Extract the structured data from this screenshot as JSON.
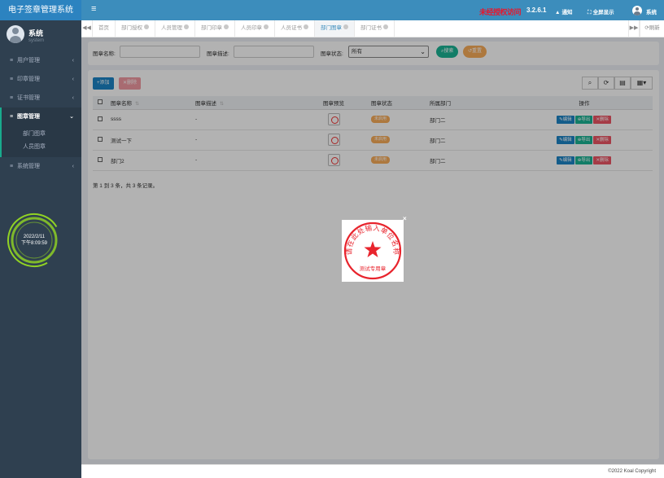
{
  "app": {
    "title": "电子签章管理系统"
  },
  "user": {
    "name": "系统",
    "role": "system"
  },
  "sidebar": {
    "items": [
      {
        "label": "用户管理",
        "chevron": "‹"
      },
      {
        "label": "印章管理",
        "chevron": "‹"
      },
      {
        "label": "证书管理",
        "chevron": "‹"
      },
      {
        "label": "图章管理",
        "chevron": "⌄"
      },
      {
        "label": "系统管理",
        "chevron": "‹"
      }
    ],
    "submenu": [
      {
        "label": "部门图章"
      },
      {
        "label": "人员图章"
      }
    ]
  },
  "clock": {
    "date": "2022/2/11",
    "time": "下午8:09:59",
    "ring_color": "#9be21f"
  },
  "header": {
    "menu_icon": "≡",
    "marquee": "未经授权访问",
    "version": "3.2.6.1",
    "notify_label": "通知",
    "fullscreen_label": "全屏显示",
    "user_label": "系统"
  },
  "tabs": {
    "items": [
      {
        "label": "首页",
        "closable": false
      },
      {
        "label": "部门授权",
        "closable": true
      },
      {
        "label": "人员管理",
        "closable": true
      },
      {
        "label": "部门印章",
        "closable": true
      },
      {
        "label": "人员印章",
        "closable": true
      },
      {
        "label": "人员证书",
        "closable": true
      },
      {
        "label": "部门图章",
        "closable": true,
        "active": true
      },
      {
        "label": "部门证书",
        "closable": true
      }
    ],
    "refresh_label": "刷新",
    "left_arrow": "◀◀",
    "right_arrow": "▶▶"
  },
  "search": {
    "name_label": "图章名称:",
    "desc_label": "图章描述:",
    "status_label": "图章状态:",
    "status_value": "所有",
    "search_button": "搜索",
    "reset_button": "重置",
    "name_value": "",
    "desc_value": ""
  },
  "toolbar": {
    "add_label": "添加",
    "delete_label": "删除"
  },
  "table": {
    "headers": {
      "name": "图章名称",
      "desc": "图章描述",
      "preview": "图章预览",
      "status": "图章状态",
      "dept": "所属部门",
      "ops": "操作"
    },
    "rows": [
      {
        "name": "ssss",
        "desc": "-",
        "status": "未启用",
        "dept": "部门二"
      },
      {
        "name": "测试一下",
        "desc": "-",
        "status": "未启用",
        "dept": "部门二"
      },
      {
        "name": "部门2",
        "desc": "-",
        "status": "未启用",
        "dept": "部门二"
      }
    ],
    "op_edit": "编辑",
    "op_export": "导出",
    "op_delete": "删除",
    "pager_text": "第 1 到 3 条，共 3 条记录。"
  },
  "footer": {
    "copyright": "©2022 Koal Copyright"
  },
  "lightbox": {
    "close": "×",
    "seal_top_text": "请在此处输入单位名称",
    "seal_bottom_text": "测试专用章",
    "seal_color": "#e8242d"
  }
}
